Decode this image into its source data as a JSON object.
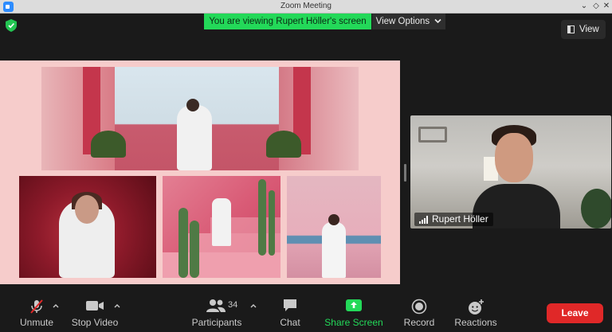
{
  "window": {
    "title": "Zoom Meeting"
  },
  "banner": {
    "viewing_text": "You are viewing Rupert Höller's screen",
    "view_options_label": "View Options",
    "view_button_label": "View"
  },
  "participant_tile": {
    "name": "Rupert Höller"
  },
  "toolbar": {
    "unmute_label": "Unmute",
    "stop_video_label": "Stop Video",
    "participants_label": "Participants",
    "participants_count": "34",
    "chat_label": "Chat",
    "share_screen_label": "Share Screen",
    "record_label": "Record",
    "reactions_label": "Reactions",
    "leave_label": "Leave"
  },
  "colors": {
    "banner_green": "#23d959",
    "share_icon_green": "#23d959",
    "leave_red": "#e02828",
    "shared_bg_pink": "#f6cccb"
  },
  "icons": [
    "zoom-app-icon",
    "shield-icon",
    "chevron-down-icon",
    "view-layout-icon",
    "signal-bars-icon",
    "muted-mic-icon",
    "video-camera-icon",
    "participants-icon",
    "chat-icon",
    "share-screen-icon",
    "record-icon",
    "reactions-icon"
  ]
}
